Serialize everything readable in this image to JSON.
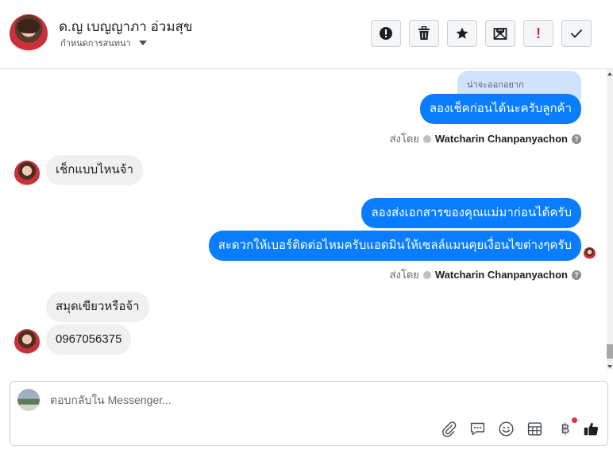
{
  "header": {
    "contact_name": "ด.ญ เบญญาภา อ่วมสุข",
    "subtitle": "กำหนดการสนทนา",
    "actions": [
      {
        "name": "report-icon"
      },
      {
        "name": "trash-icon"
      },
      {
        "name": "star-icon"
      },
      {
        "name": "mark-unread-icon"
      },
      {
        "name": "important-icon",
        "label": "!"
      },
      {
        "name": "done-check-icon"
      }
    ]
  },
  "messages": {
    "quoted_text": "น่าจะออกอยาก",
    "out_1": "ลองเช็คก่อนได้นะครับลูกค้า",
    "sent_by_label_1": "ส่งโดย",
    "sent_by_name_1": "Watcharin Chanpanyachon",
    "in_1": "เช็กแบบไหนจ้า",
    "out_2": "ลองส่งเอกสารของคุณแม่มาก่อนได้ครับ",
    "out_3": "สะดวกให้เบอร์ติดต่อไหมครับแอดมินให้เซลล์แมนคุยเงื่อนไขต่างๆครับ",
    "sent_by_label_2": "ส่งโดย",
    "sent_by_name_2": "Watcharin Chanpanyachon",
    "in_2": "สมุดเขียวหรือจ้า",
    "in_3": "0967056375"
  },
  "composer": {
    "placeholder": "ตอบกลับใน Messenger...",
    "tools": [
      "attachment-icon",
      "saved-reply-icon",
      "emoji-icon",
      "appointment-icon",
      "payment-icon",
      "like-icon"
    ],
    "payment_symbol": "฿"
  },
  "colors": {
    "outgoing_bubble": "#0a7cff",
    "incoming_bubble": "#f0f0f0",
    "quote_bubble": "#cfe3fc",
    "notification_dot": "#f02849",
    "important_red": "#e41e3f"
  }
}
